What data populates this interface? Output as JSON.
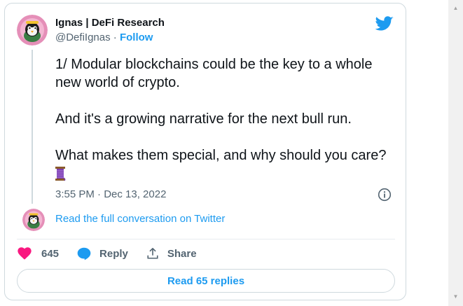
{
  "tweet": {
    "author_name": "Ignas | DeFi Research",
    "author_handle": "@DefiIgnas",
    "handle_separator": " · ",
    "follow_label": "Follow",
    "text_paragraphs": [
      "1/ Modular blockchains could be the key to a whole new world of crypto.",
      "And it's a growing narrative for the next bull run.",
      "What makes them special, and why should you care?"
    ],
    "trailing_emoji": "thread-spool-icon",
    "timestamp": "3:55 PM · Dec 13, 2022"
  },
  "conversation": {
    "link_text": "Read the full conversation on Twitter"
  },
  "actions": {
    "like_count": "645",
    "reply_label": "Reply",
    "share_label": "Share"
  },
  "replies_button": {
    "label": "Read 65 replies"
  },
  "colors": {
    "accent": "#1d9bf0",
    "like": "#f91880",
    "text_primary": "#0f1419",
    "text_secondary": "#536471",
    "border": "#cfd9de"
  },
  "icons": {
    "brand": "twitter-bird-icon",
    "info": "info-icon",
    "like": "heart-icon",
    "reply": "speech-bubble-icon",
    "share": "share-upload-icon"
  }
}
